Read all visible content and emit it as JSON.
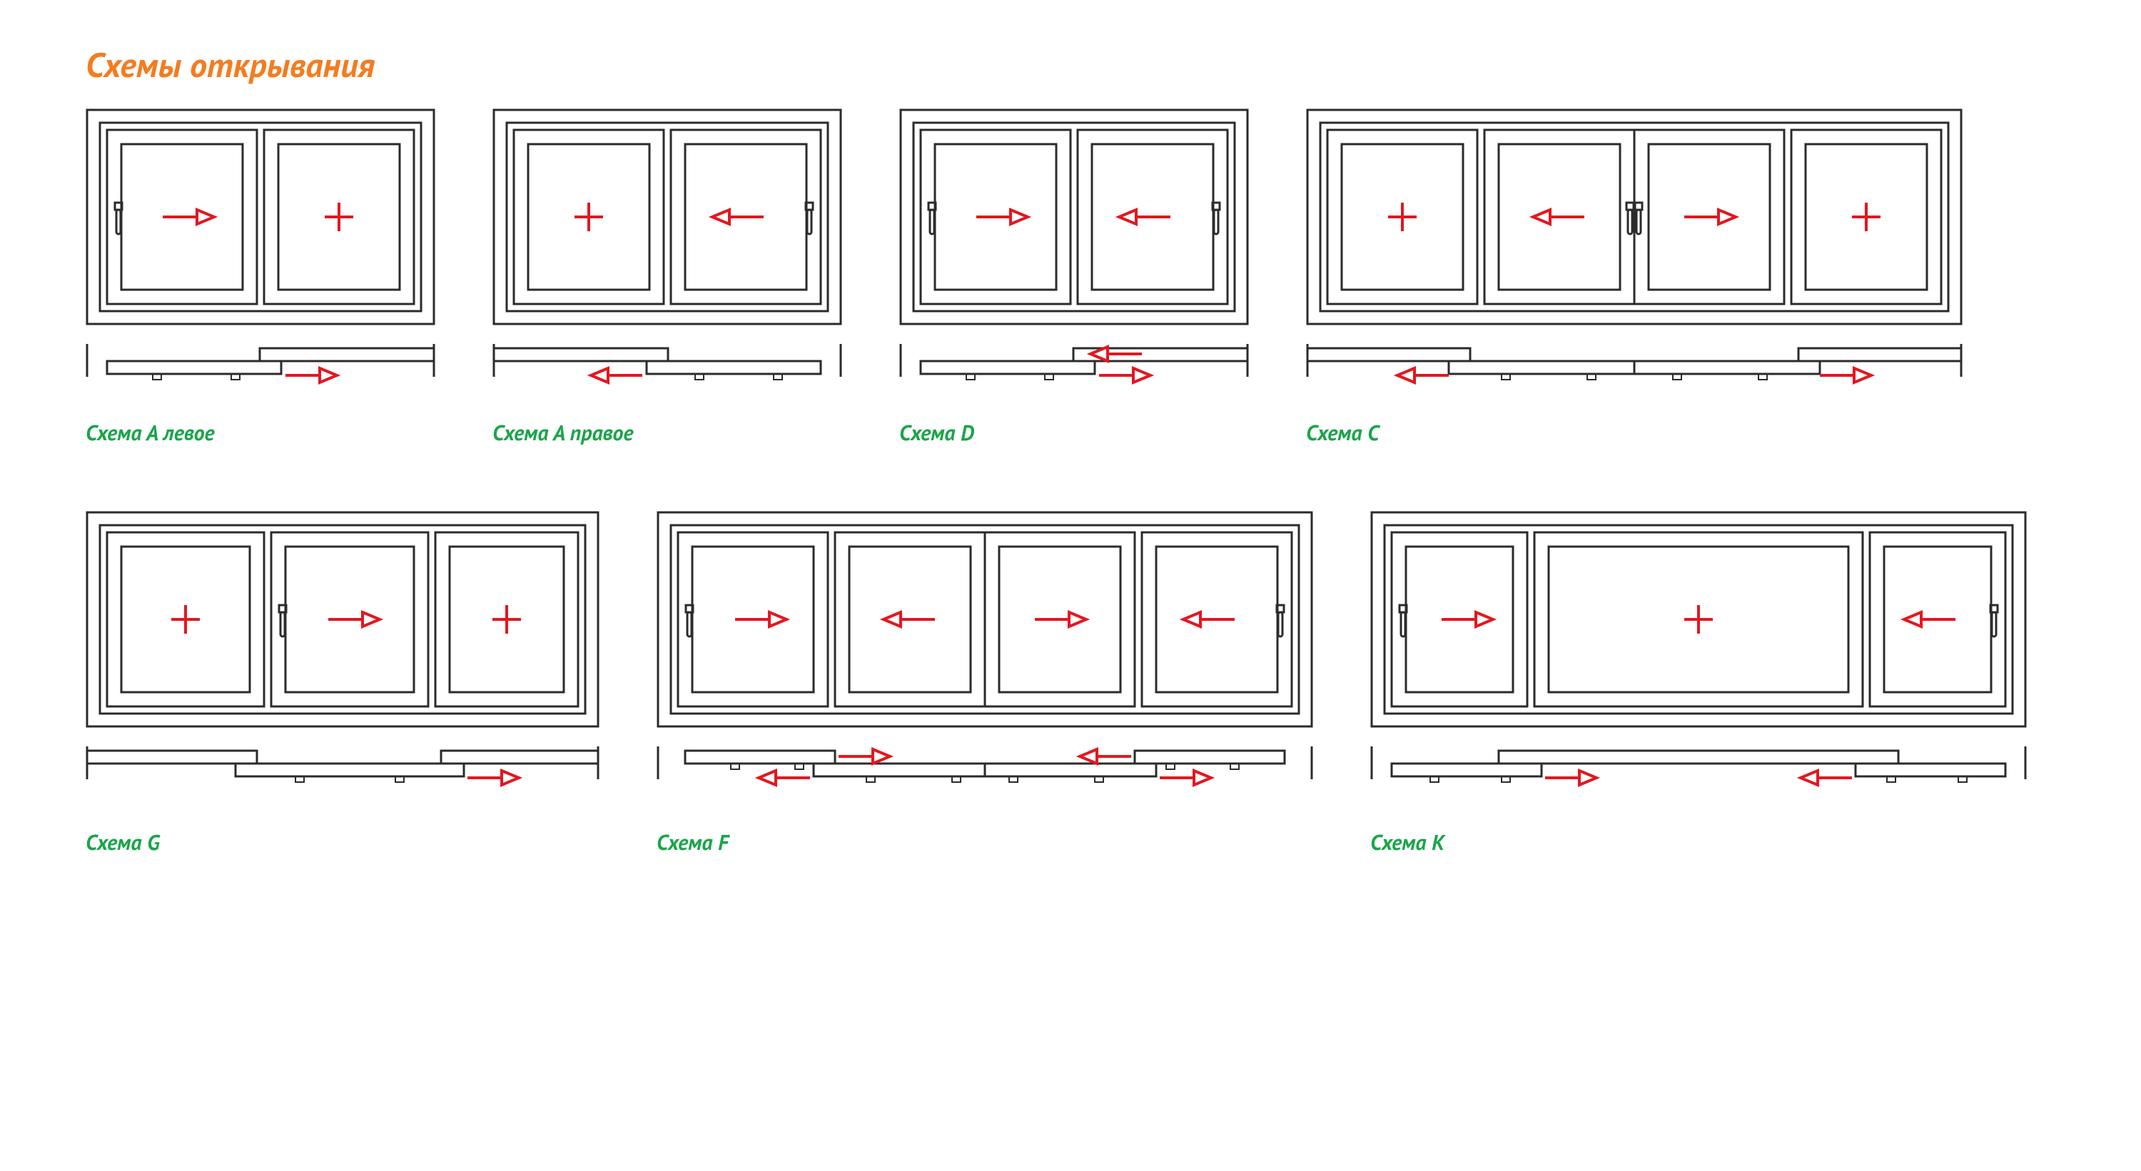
{
  "title": "Схемы открывания",
  "accentColor": "#f47c20",
  "labelColor": "#1aa54a",
  "strokeColor": "#2b2b2b",
  "markColor": "#e3171f",
  "schemes": {
    "a_left": {
      "label": "Схема А левое"
    },
    "a_right": {
      "label": "Схема А правое"
    },
    "d": {
      "label": "Схема D"
    },
    "c": {
      "label": "Схема C"
    },
    "g": {
      "label": "Схема G"
    },
    "f": {
      "label": "Схема F"
    },
    "k": {
      "label": "Схема K"
    }
  },
  "legend": {
    "arrow": "sliding-sash-direction",
    "plus": "fixed-sash"
  },
  "chart_data": [
    {
      "scheme": "A левое",
      "sashes": [
        "slide-right",
        "fixed"
      ],
      "plan_tracks": [
        [
          "front",
          "back"
        ]
      ],
      "plan_arrows": [
        "right"
      ]
    },
    {
      "scheme": "A правое",
      "sashes": [
        "fixed",
        "slide-left"
      ],
      "plan_tracks": [
        [
          "back",
          "front"
        ]
      ],
      "plan_arrows": [
        "left"
      ]
    },
    {
      "scheme": "D",
      "sashes": [
        "slide-right",
        "slide-left"
      ],
      "plan_tracks": [
        [
          "front",
          "back"
        ]
      ],
      "plan_arrows": [
        "left",
        "right"
      ]
    },
    {
      "scheme": "C",
      "sashes": [
        "fixed",
        "slide-left",
        "slide-right",
        "fixed"
      ],
      "plan_tracks": [
        [
          "back",
          "front"
        ],
        [
          "front",
          "back"
        ]
      ],
      "plan_arrows": [
        "left",
        "right"
      ]
    },
    {
      "scheme": "G",
      "sashes": [
        "fixed",
        "slide-right",
        "fixed"
      ],
      "plan_tracks": [
        [
          "back",
          "front",
          "back"
        ]
      ],
      "plan_arrows": [
        "right"
      ]
    },
    {
      "scheme": "F",
      "sashes": [
        "slide-right",
        "slide-left",
        "slide-right",
        "slide-left"
      ],
      "plan_tracks": [
        [
          "back",
          "front"
        ],
        [
          "front",
          "back"
        ]
      ],
      "plan_arrows": [
        "left",
        "right",
        "left",
        "right"
      ]
    },
    {
      "scheme": "K",
      "sashes": [
        "slide-right",
        "fixed-wide",
        "slide-left"
      ],
      "plan_tracks": [
        [
          "front",
          "back",
          "front"
        ]
      ],
      "plan_arrows": [
        "right",
        "left"
      ]
    }
  ]
}
